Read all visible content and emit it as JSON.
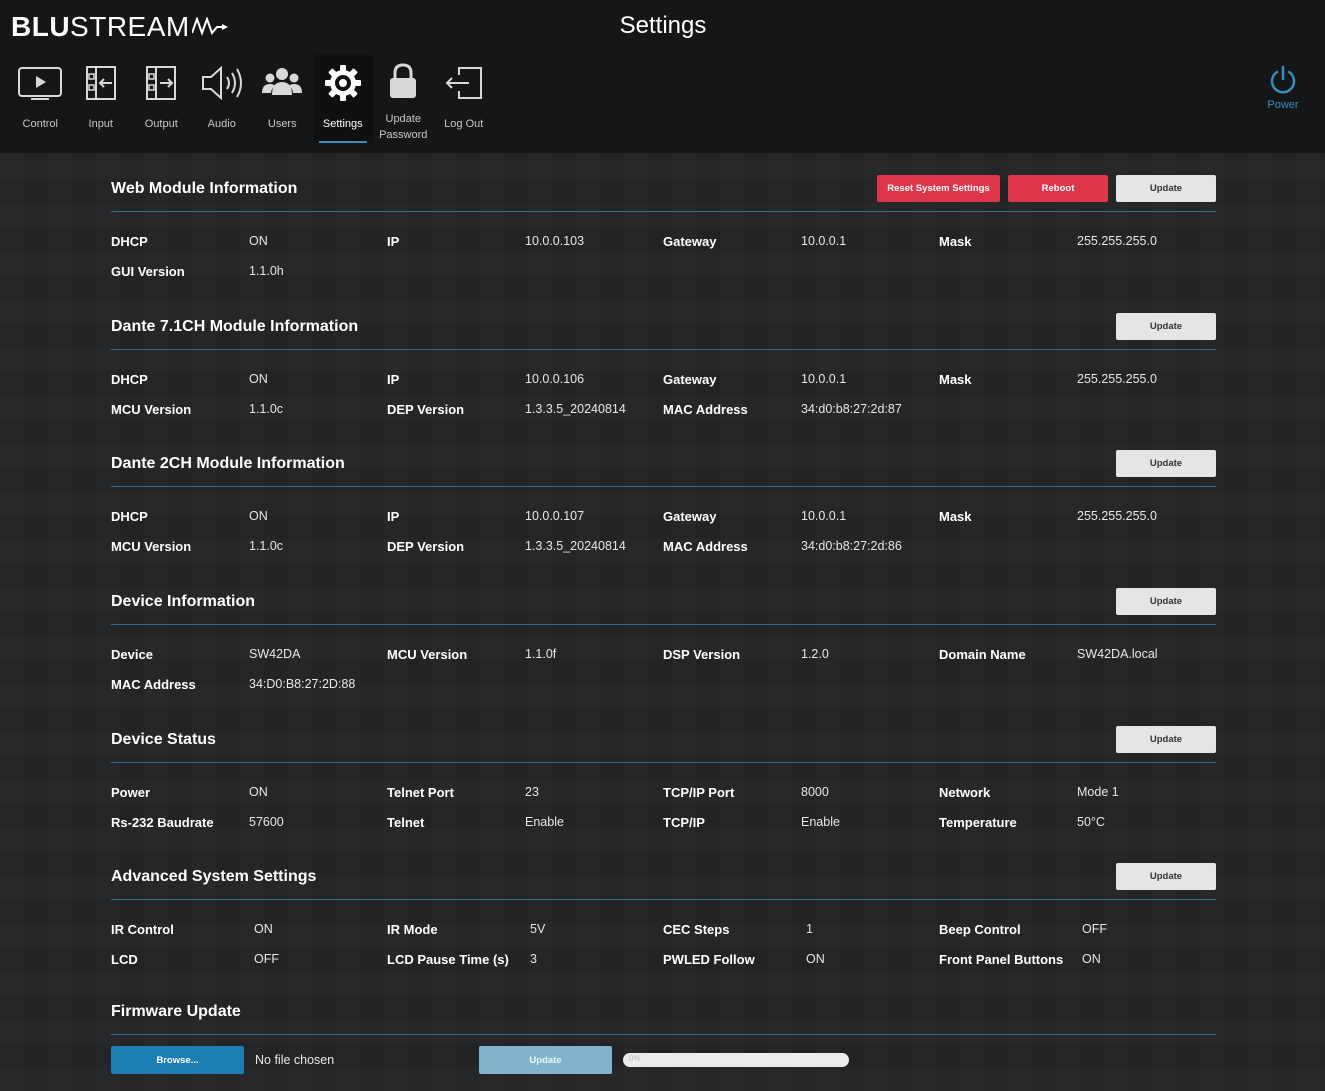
{
  "header": {
    "logo_bold": "BLU",
    "logo_rest": "STREAM",
    "title": "Settings",
    "power_label": "Power",
    "accent_color": "#3b8dbd"
  },
  "nav": [
    {
      "label": "Control",
      "icon": "play-screen-icon"
    },
    {
      "label": "Input",
      "icon": "input-arrow-icon"
    },
    {
      "label": "Output",
      "icon": "output-arrow-icon"
    },
    {
      "label": "Audio",
      "icon": "speaker-icon"
    },
    {
      "label": "Users",
      "icon": "users-icon"
    },
    {
      "label": "Settings",
      "icon": "gear-icon",
      "active": true
    },
    {
      "label": "Update Password",
      "icon": "lock-icon"
    },
    {
      "label": "Log Out",
      "icon": "logout-icon"
    }
  ],
  "web_module": {
    "title": "Web Module Information",
    "reset_label": "Reset System Settings",
    "reboot_label": "Reboot",
    "update_label": "Update",
    "rows": [
      [
        {
          "k": "DHCP",
          "v": "ON"
        },
        {
          "k": "IP",
          "v": "10.0.0.103"
        },
        {
          "k": "Gateway",
          "v": "10.0.0.1"
        },
        {
          "k": "Mask",
          "v": "255.255.255.0"
        }
      ],
      [
        {
          "k": "GUI Version",
          "v": "1.1.0h"
        }
      ]
    ]
  },
  "dante71": {
    "title": "Dante 7.1CH Module Information",
    "update_label": "Update",
    "rows": [
      [
        {
          "k": "DHCP",
          "v": "ON"
        },
        {
          "k": "IP",
          "v": "10.0.0.106"
        },
        {
          "k": "Gateway",
          "v": "10.0.0.1"
        },
        {
          "k": "Mask",
          "v": "255.255.255.0"
        }
      ],
      [
        {
          "k": "MCU Version",
          "v": "1.1.0c"
        },
        {
          "k": "DEP Version",
          "v": "1.3.3.5_20240814"
        },
        {
          "k": "MAC Address",
          "v": "34:d0:b8:27:2d:87"
        }
      ]
    ]
  },
  "dante2": {
    "title": "Dante 2CH Module Information",
    "update_label": "Update",
    "rows": [
      [
        {
          "k": "DHCP",
          "v": "ON"
        },
        {
          "k": "IP",
          "v": "10.0.0.107"
        },
        {
          "k": "Gateway",
          "v": "10.0.0.1"
        },
        {
          "k": "Mask",
          "v": "255.255.255.0"
        }
      ],
      [
        {
          "k": "MCU Version",
          "v": "1.1.0c"
        },
        {
          "k": "DEP Version",
          "v": "1.3.3.5_20240814"
        },
        {
          "k": "MAC Address",
          "v": "34:d0:b8:27:2d:86"
        }
      ]
    ]
  },
  "device_info": {
    "title": "Device Information",
    "update_label": "Update",
    "rows": [
      [
        {
          "k": "Device",
          "v": "SW42DA"
        },
        {
          "k": "MCU Version",
          "v": "1.1.0f"
        },
        {
          "k": "DSP Version",
          "v": "1.2.0"
        },
        {
          "k": "Domain Name",
          "v": "SW42DA.local"
        }
      ],
      [
        {
          "k": "MAC Address",
          "v": "34:D0:B8:27:2D:88"
        }
      ]
    ]
  },
  "device_status": {
    "title": "Device Status",
    "update_label": "Update",
    "rows": [
      [
        {
          "k": "Power",
          "v": "ON"
        },
        {
          "k": "Telnet Port",
          "v": "23"
        },
        {
          "k": "TCP/IP Port",
          "v": "8000"
        },
        {
          "k": "Network",
          "v": "Mode 1"
        }
      ],
      [
        {
          "k": "Rs-232 Baudrate",
          "v": "57600"
        },
        {
          "k": "Telnet",
          "v": "Enable"
        },
        {
          "k": "TCP/IP",
          "v": "Enable"
        },
        {
          "k": "Temperature",
          "v": "50°C"
        }
      ]
    ]
  },
  "advanced": {
    "title": "Advanced System Settings",
    "update_label": "Update",
    "rows": [
      [
        {
          "k": "IR Control",
          "v": "ON"
        },
        {
          "k": "IR Mode",
          "v": "5V"
        },
        {
          "k": "CEC Steps",
          "v": "1"
        },
        {
          "k": "Beep Control",
          "v": "OFF"
        }
      ],
      [
        {
          "k": "LCD",
          "v": "OFF"
        },
        {
          "k": "LCD Pause Time (s)",
          "v": "3"
        },
        {
          "k": "PWLED Follow",
          "v": "ON"
        },
        {
          "k": "Front Panel Buttons",
          "v": "ON"
        }
      ]
    ]
  },
  "firmware": {
    "title": "Firmware Update",
    "browse_label": "Browse...",
    "file_status": "No file chosen",
    "update_label": "Update",
    "progress_text": "0%",
    "progress_fraction": 0
  }
}
